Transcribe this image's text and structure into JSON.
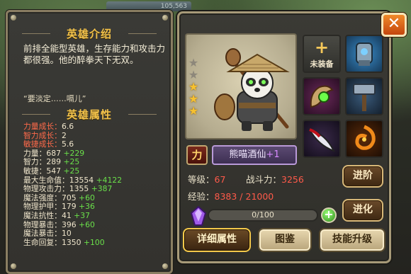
{
  "header": {
    "top_value": "105,563"
  },
  "intro": {
    "title": "英雄介绍",
    "text": "前排全能型英雄，生存能力和攻击力都很强。他的醉拳天下无双。",
    "quote": "“要淡定……嗝儿”"
  },
  "attributes": {
    "title": "英雄属性",
    "growth": [
      {
        "key": "力量成长：",
        "value": "6.6"
      },
      {
        "key": "智力成长：",
        "value": "2"
      },
      {
        "key": "敏捷成长：",
        "value": "5.6"
      }
    ],
    "stats": [
      {
        "key": "力量：",
        "value": "687",
        "bonus": "+229"
      },
      {
        "key": "智力：",
        "value": "289",
        "bonus": "+25"
      },
      {
        "key": "敏捷：",
        "value": "547",
        "bonus": "+25"
      },
      {
        "key": "最大生命值：",
        "value": "13554",
        "bonus": "+4122"
      },
      {
        "key": "物理攻击力：",
        "value": "1355",
        "bonus": "+387"
      },
      {
        "key": "魔法强度：",
        "value": "705",
        "bonus": "+60"
      },
      {
        "key": "物理护甲：",
        "value": "179",
        "bonus": "+36"
      },
      {
        "key": "魔法抗性：",
        "value": "41",
        "bonus": "+37"
      },
      {
        "key": "物理暴击：",
        "value": "396",
        "bonus": "+60"
      },
      {
        "key": "魔法暴击：",
        "value": "10",
        "bonus": ""
      },
      {
        "key": "生命回复：",
        "value": "1350",
        "bonus": "+100"
      }
    ]
  },
  "hero": {
    "stars_filled": 3,
    "stars_total": 5,
    "power_badge": "力",
    "name": "熊喵酒仙",
    "name_plus": "+1",
    "level_label": "等级：",
    "level": "67",
    "power_label": "战斗力：",
    "power": "3256",
    "exp_label": "经验：",
    "exp": "8383 / 21000",
    "soul_progress": "0/100",
    "soul_fraction": 0.0
  },
  "equipment": {
    "empty_slot_label": "未装备",
    "slots": [
      {
        "icon": "empty-slot-icon",
        "state": "empty"
      },
      {
        "icon": "mech-gauntlet-icon",
        "state": "equipped"
      },
      {
        "icon": "green-orb-claw-icon",
        "state": "equipped"
      },
      {
        "icon": "war-hammer-icon",
        "state": "equipped"
      },
      {
        "icon": "bloody-blade-icon",
        "state": "equipped"
      },
      {
        "icon": "fire-swirl-icon",
        "state": "equipped"
      }
    ]
  },
  "buttons": {
    "advance": "进阶",
    "evolve": "进化",
    "details": "详细属性",
    "guide": "图鉴",
    "skill_upgrade": "技能升级",
    "close": "✕"
  },
  "colors": {
    "accent_gold": "#f2c24b",
    "growth_red": "#ff6a4a",
    "bonus_green": "#6ae04a",
    "stat_red": "#ff5a4a",
    "name_purple": "#b99ad8"
  }
}
